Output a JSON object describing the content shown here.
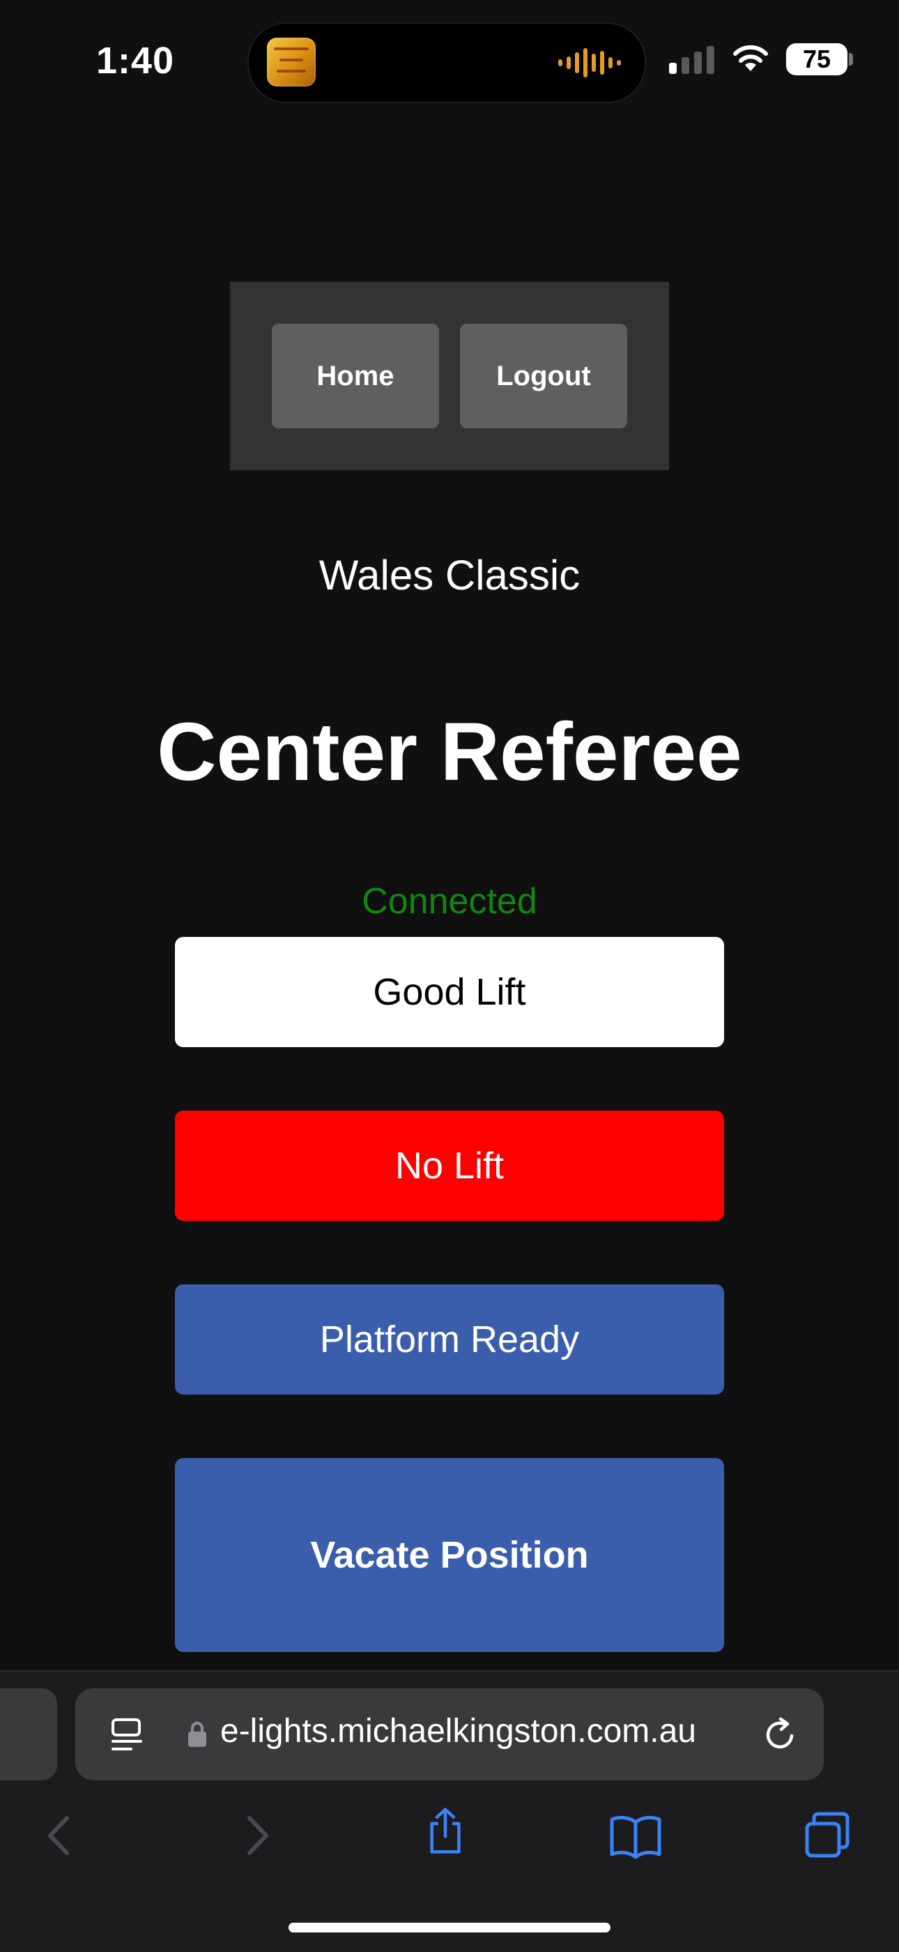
{
  "status_bar": {
    "time": "1:40",
    "battery": "75",
    "signal_bars_active": 1,
    "now_playing_art": "album-art",
    "waveform_color": "#e39b27"
  },
  "nav": {
    "home_label": "Home",
    "logout_label": "Logout"
  },
  "competition_name": "Wales Classic",
  "page_title": "Center Referee",
  "connection_status": "Connected",
  "actions": {
    "good_lift": "Good Lift",
    "no_lift": "No Lift",
    "platform_ready": "Platform Ready",
    "vacate_position": "Vacate Position"
  },
  "colors": {
    "background": "#101011",
    "nav_box": "#333333",
    "nav_button": "#5f5f5f",
    "connected": "#128512",
    "good_lift": "#ffffff",
    "no_lift": "#ff0000",
    "blue_button": "#3a5eac",
    "safari_blue": "#3b82f6"
  },
  "browser": {
    "url": "e-lights.michaelkingston.com.au",
    "icons": [
      "reader-icon",
      "lock-icon",
      "reload-icon",
      "back-icon",
      "forward-icon",
      "share-icon",
      "bookmarks-icon",
      "tabs-icon"
    ]
  }
}
